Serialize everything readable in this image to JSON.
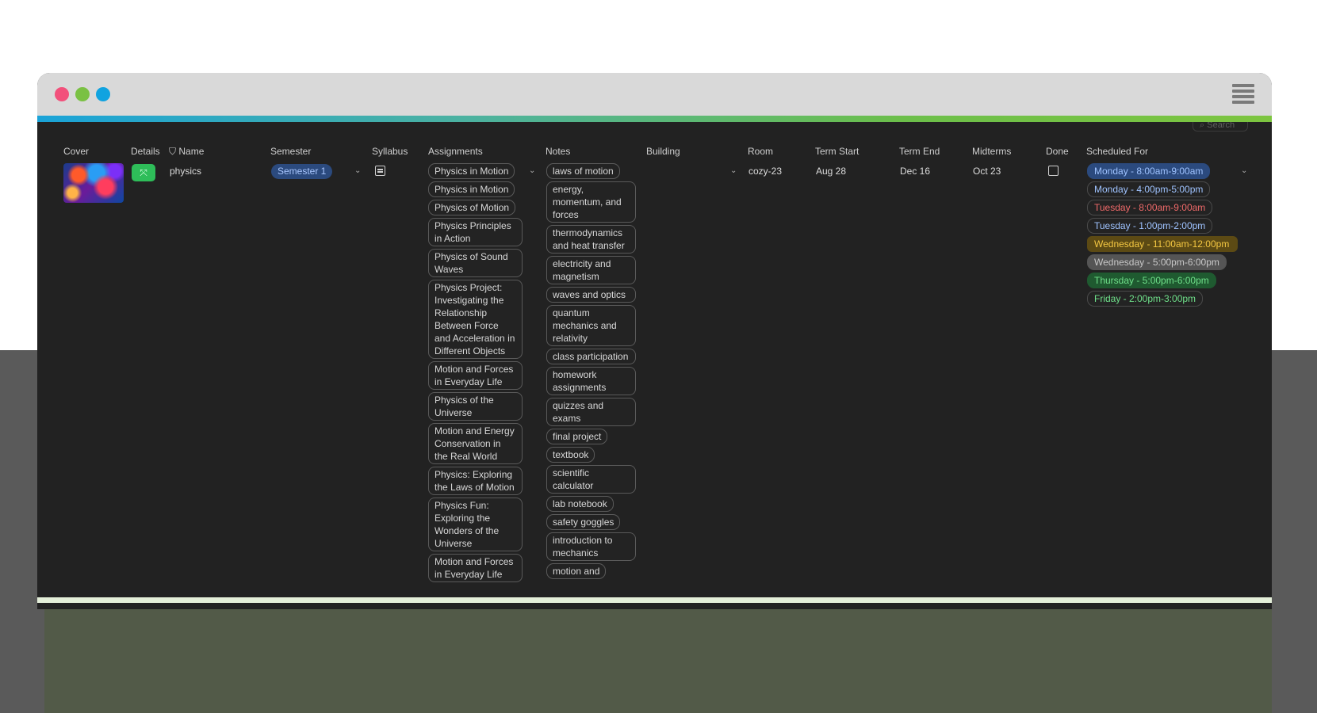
{
  "window": {
    "search_placeholder": "Search"
  },
  "headers": {
    "cover": "Cover",
    "details": "Details",
    "name": "Name",
    "semester": "Semester",
    "syllabus": "Syllabus",
    "assignments": "Assignments",
    "notes": "Notes",
    "building": "Building",
    "room": "Room",
    "term_start": "Term Start",
    "term_end": "Term End",
    "midterms": "Midterms",
    "done": "Done",
    "scheduled_for": "Scheduled For"
  },
  "row": {
    "details_icon": "expand-icon",
    "name": "physics",
    "semester": "Semester 1",
    "building": "",
    "room": "cozy-23",
    "term_start": "Aug 28",
    "term_end": "Dec 16",
    "midterms": "Oct 23",
    "done": false,
    "assignments": [
      "Physics in Motion",
      "Physics in Motion",
      "Physics of Motion",
      "Physics Principles in Action",
      "Physics of Sound Waves",
      "Physics Project: Investigating the Relationship Between Force and Acceleration in Different Objects",
      "Motion and Forces in Everyday Life",
      "Physics of the Universe",
      "Motion and Energy Conservation in the Real World",
      "Physics: Exploring the Laws of Motion",
      "Physics Fun: Exploring the Wonders of the Universe",
      "Motion and Forces in Everyday Life"
    ],
    "notes": [
      "laws of motion",
      "energy, momentum, and forces",
      "thermodynamics and heat transfer",
      "electricity and magnetism",
      "waves and optics",
      "quantum mechanics and relativity",
      "class participation",
      "homework assignments",
      "quizzes and exams",
      "final project",
      "textbook",
      "scientific calculator",
      "lab notebook",
      "safety goggles",
      "introduction to mechanics",
      "motion and"
    ],
    "scheduled_for": [
      {
        "label": "Monday - 8:00am-9:00am",
        "color": "#9fc3ff",
        "bg": "#2b4a7e",
        "border": "#2b4a7e"
      },
      {
        "label": "Monday - 4:00pm-5:00pm",
        "color": "#9fc3ff",
        "bg": "#232323",
        "border": "#4a4a4a"
      },
      {
        "label": "Tuesday - 8:00am-9:00am",
        "color": "#f06a6a",
        "bg": "#232323",
        "border": "#4a4a4a"
      },
      {
        "label": "Tuesday - 1:00pm-2:00pm",
        "color": "#9fc3ff",
        "bg": "#232323",
        "border": "#4a4a4a"
      },
      {
        "label": "Wednesday - 11:00am-12:00pm",
        "color": "#f5c842",
        "bg": "#5c4a14",
        "border": "#5c4a14"
      },
      {
        "label": "Wednesday - 5:00pm-6:00pm",
        "color": "#c8c8c8",
        "bg": "#555555",
        "border": "#555555"
      },
      {
        "label": "Thursday - 5:00pm-6:00pm",
        "color": "#6fe08a",
        "bg": "#1f5a30",
        "border": "#1f5a30"
      },
      {
        "label": "Friday - 2:00pm-3:00pm",
        "color": "#6fe08a",
        "bg": "#232323",
        "border": "#4a4a4a"
      }
    ]
  }
}
